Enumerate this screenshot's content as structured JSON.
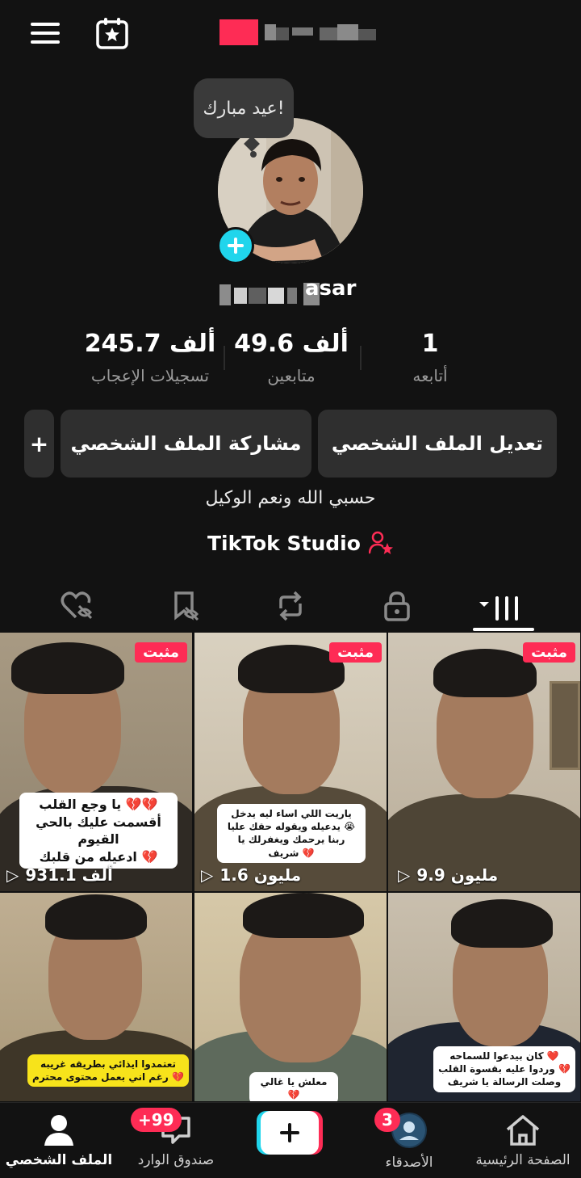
{
  "top": {
    "menu_icon": "hamburger-icon",
    "calendar_icon": "calendar-star-icon"
  },
  "profile": {
    "bubble_text": "عيد مبارك!",
    "handle_visible": "asar"
  },
  "stats": [
    {
      "value": "1",
      "label": "أتابعه"
    },
    {
      "value": "49.6 ألف",
      "label": "متابعين"
    },
    {
      "value": "245.7 ألف",
      "label": "تسجيلات الإعجاب"
    }
  ],
  "buttons": {
    "edit": "تعديل الملف الشخصي",
    "share": "مشاركة الملف الشخصي",
    "more": "+"
  },
  "bio": "حسبي الله ونعم الوكيل",
  "studio": "TikTok Studio",
  "tabs": [
    "grid-icon",
    "lock-icon",
    "repost-icon",
    "saved-icon",
    "liked-icon"
  ],
  "videos": [
    {
      "pinned": "مثبت",
      "views": "9.9 مليون",
      "caption": ""
    },
    {
      "pinned": "مثبت",
      "views": "1.6 مليون",
      "caption_lines": [
        "ياريت اللي اساء ليه يدخل",
        "يدعيله ويقوله حقك عليا 😭",
        "ربنا يرحمك ويغفرلك يا شريف 💔"
      ]
    },
    {
      "pinned": "مثبت",
      "views": "931.1 ألف",
      "caption_lines": [
        "يا وجع القلب 💔💔",
        "أقسمت عليك بالحي القيوم",
        "ادعيله من قلبك 💔"
      ]
    },
    {
      "caption_lines": [
        "كان بيدعوا للسماحه ❤️",
        "وردوا عليه بقسوة القلب 💔",
        "وصلت الرسالة يا شريف"
      ]
    },
    {
      "caption_lines": [
        "معلش يا غالي 💔"
      ]
    },
    {
      "caption_lines": [
        "تعتمدوا ايذائي بطريقه غريبه",
        "رغم اني بعمل محتوى محترم 💔"
      ]
    }
  ],
  "nav": {
    "home": "الصفحة الرئيسية",
    "friends": "الأصدقاء",
    "friends_badge": "3",
    "inbox": "صندوق الوارد",
    "inbox_badge": "+99",
    "profile": "الملف الشخصي"
  },
  "colors": {
    "accent": "#fe2c55",
    "cyan": "#20d5ec",
    "background": "#121212"
  }
}
